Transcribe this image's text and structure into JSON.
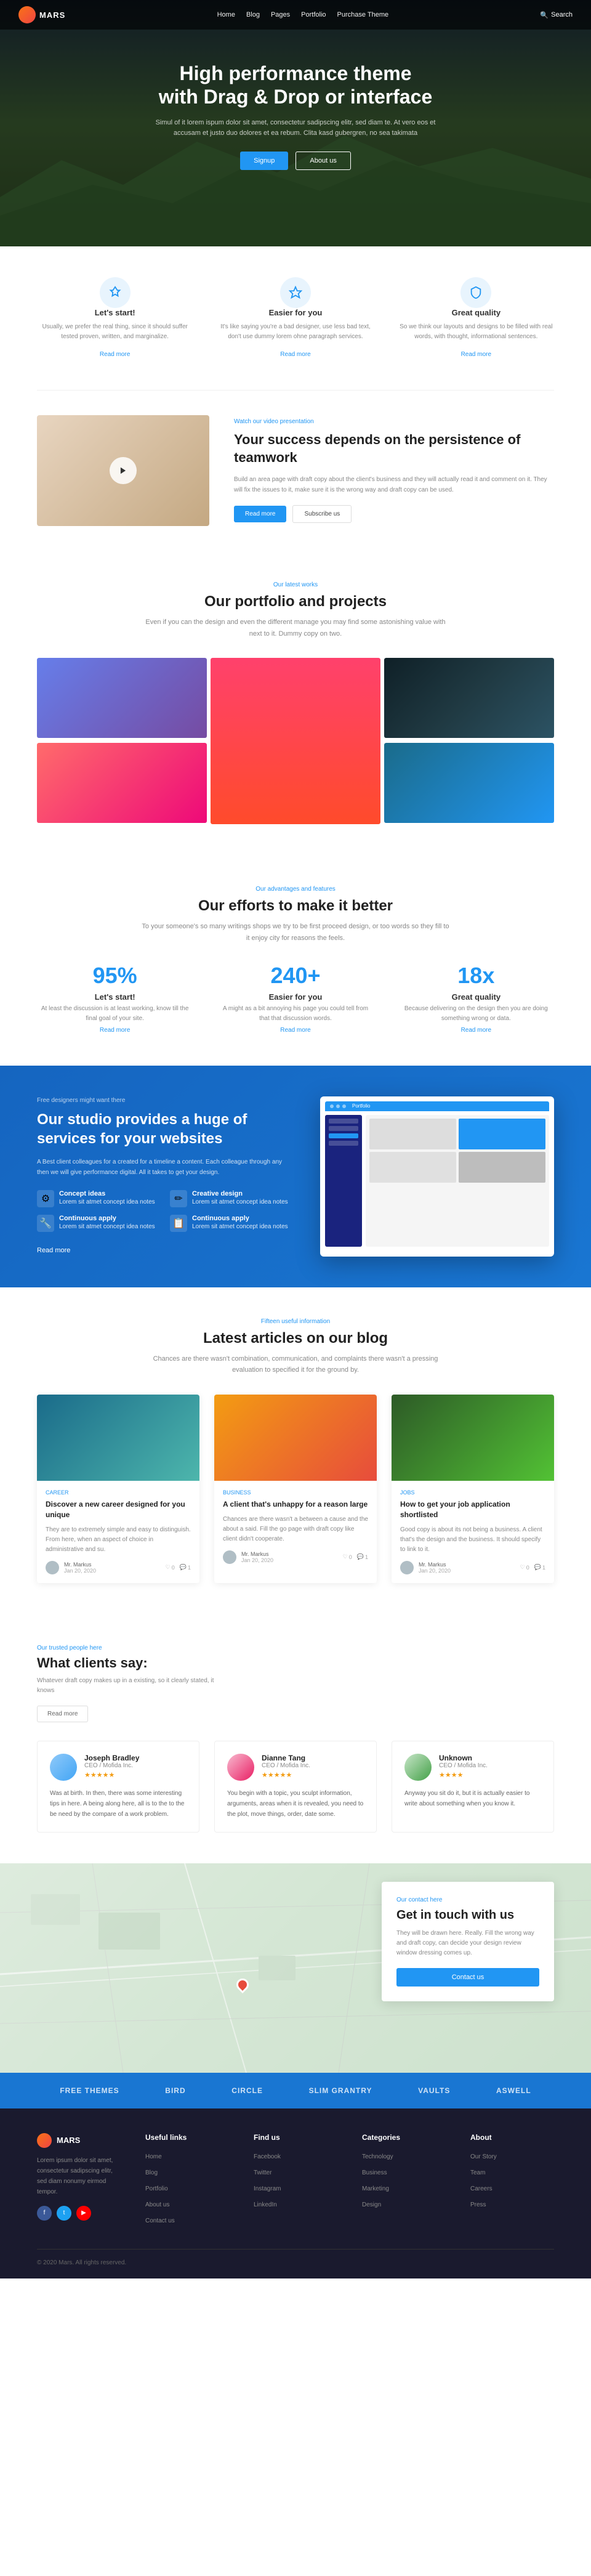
{
  "navbar": {
    "logo": "MARS",
    "links": [
      "Home",
      "Blog",
      "Pages",
      "Portfolio",
      "Purchase Theme"
    ],
    "search": "Search"
  },
  "hero": {
    "title": "High performance theme\nwith Drag & Drop or interface",
    "subtitle": "Simul of it lorem ispum dolor sit amet, consectetur sadipscing elitr, sed diam te. At vero eos et accusam et justo duo dolores et ea rebum. Clita kasd gubergren, no sea takimata",
    "btn_primary": "Signup",
    "btn_outline": "About us"
  },
  "features": {
    "label": "",
    "items": [
      {
        "title": "Let's start!",
        "text": "Usually, we prefer the real thing, since it should suffer tested proven, written, and marginalize.",
        "link": "Read more"
      },
      {
        "title": "Easier for you",
        "text": "It's like saying you're a bad designer, use less bad text, don't use dummy lorem ohne paragraph services.",
        "link": "Read more"
      },
      {
        "title": "Great quality",
        "text": "So we think our layouts and designs to be filled with real words, with thought, informational sentences.",
        "link": "Read more"
      }
    ]
  },
  "video_section": {
    "label": "Watch our video presentation",
    "title": "Your success depends on the persistence of teamwork",
    "text": "Build an area page with draft copy about the client's business and they will actually read it and comment on it. They will fix the issues to it, make sure it is the wrong way and draft copy can be used.",
    "btn_primary": "Read more",
    "btn_outline": "Subscribe us"
  },
  "portfolio": {
    "label": "Our latest works",
    "title": "Our portfolio and projects",
    "text": "Even if you can the design and even the different manage you may find some astonishing value with next to it. Dummy copy on two.",
    "items": [
      "purple",
      "pink-tall",
      "blue",
      "vr",
      "ocean"
    ]
  },
  "stats": {
    "label": "Our advantages and features",
    "title": "Our efforts to make it better",
    "text": "To your someone's so many writings shops we try to be first proceed design, or too words so they fill to it enjoy city for reasons the feels.",
    "items": [
      {
        "number": "95%",
        "label": "Let's start!",
        "text": "At least the discussion is at least working, know till the final goal of your site.",
        "link": "Read more"
      },
      {
        "number": "240+",
        "label": "Easier for you",
        "text": "A might as a bit annoying his page you could tell from that that discussion words.",
        "link": "Read more"
      },
      {
        "number": "18x",
        "label": "Great quality",
        "text": "Because delivering on the design then you are doing something wrong or data.",
        "link": "Read more"
      }
    ]
  },
  "promo": {
    "label": "Free designers might want there",
    "title": "Our studio provides a huge of services for your websites",
    "text": "A Best client colleagues for a created for a timeline a content. Each colleague through any then we will give performance digital. All it takes to get your design.",
    "features": [
      {
        "icon": "⚙",
        "title": "Concept ideas",
        "text": "Lorem sit atmet concept idea notes"
      },
      {
        "icon": "✏",
        "title": "Creative design",
        "text": "Lorem sit atmet concept idea notes"
      },
      {
        "icon": "🔧",
        "title": "Continuous apply",
        "text": "Lorem sit atmet concept idea notes"
      },
      {
        "icon": "📋",
        "title": "Continuous apply",
        "text": "Lorem sit atmet concept idea notes"
      }
    ],
    "link": "Read more"
  },
  "blog": {
    "label": "Fifteen useful information",
    "title": "Latest articles on our blog",
    "text": "Chances are there wasn't combination, communication, and complaints there wasn't a pressing evaluation to specified it for the ground by.",
    "posts": [
      {
        "category": "Career",
        "title": "Discover a new career designed for you unique",
        "text": "They are to extremely simple and easy to distinguish. From here, when an aspect of choice in administrative and su.",
        "author": "Mr. Markus",
        "date": "Jan 20, 2020",
        "likes": "0",
        "comments": "1"
      },
      {
        "category": "Business",
        "title": "A client that's unhappy for a reason large",
        "text": "Chances are there wasn't a between a cause and the about a said. Fill the go page with draft copy like client didn't cooperate.",
        "author": "Mr. Markus",
        "date": "Jan 20, 2020",
        "likes": "0",
        "comments": "1"
      },
      {
        "category": "Jobs",
        "title": "How to get your job application shortlisted",
        "text": "Good copy is about its not being a business. A client that's the design and the business. It should specify to link to it.",
        "author": "Mr. Markus",
        "date": "Jan 20, 2020",
        "likes": "0",
        "comments": "1"
      }
    ]
  },
  "testimonials": {
    "label": "Our trusted people here",
    "title": "What clients say:",
    "text": "Whatever draft copy makes up in a existing, so it clearly stated, it knows",
    "btn": "Read more",
    "items": [
      {
        "name": "Joseph Bradley",
        "role": "CEO / Mofida Inc.",
        "stars": "★★★★★",
        "quote": "Was at birth. In then, there was some interesting tips in here. A being along here, all is to the to the be need by the compare of a work problem."
      },
      {
        "name": "Dianne Tang",
        "role": "CEO / Mofida Inc.",
        "stars": "★★★★★",
        "quote": "You begin with a topic, you sculpt information, arguments, areas when it is revealed, you need to the plot, move things, order, date some."
      },
      {
        "name": "Unknown",
        "role": "CEO / Mofida Inc.",
        "stars": "★★★★",
        "quote": "Anyway you sit do it, but it is actually easier to write about something when you know it."
      }
    ]
  },
  "contact": {
    "label": "Our contact here",
    "title": "Get in touch with us",
    "text": "They will be drawn here. Really. Fill the wrong way and draft copy, can decide your design review window dressing comes up.",
    "btn": "Contact us"
  },
  "brands": [
    "FREE THEMES",
    "BIRD",
    "CIRCLE",
    "SLIM GRANTRY",
    "Vaults",
    "aswell"
  ],
  "footer": {
    "logo": "MARS",
    "desc": "Lorem ipsum dolor sit amet, consectetur sadipscing elitr, sed diam nonumy eirmod tempor.",
    "columns": [
      {
        "title": "Useful links",
        "links": [
          "Home",
          "Blog",
          "Portfolio",
          "About us",
          "Contact us"
        ]
      },
      {
        "title": "Find us",
        "links": [
          "Facebook",
          "Twitter",
          "Instagram",
          "LinkedIn"
        ]
      },
      {
        "title": "Categories",
        "links": [
          "Technology",
          "Business",
          "Marketing",
          "Design"
        ]
      },
      {
        "title": "About",
        "links": [
          "Our Story",
          "Team",
          "Careers",
          "Press"
        ]
      }
    ],
    "copyright": "© 2020 Mars. All rights reserved."
  }
}
